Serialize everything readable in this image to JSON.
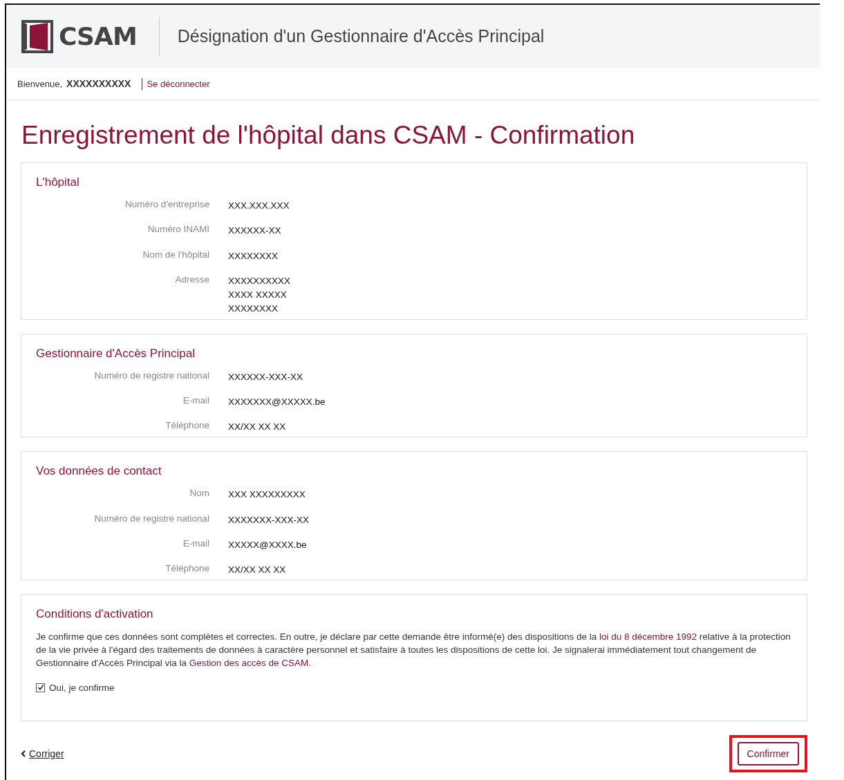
{
  "header": {
    "logo": "CSAM",
    "title": "Désignation d'un Gestionnaire d'Accès Principal"
  },
  "user_bar": {
    "greeting": "Bienvenue,",
    "user": "XXXXXXXXXX",
    "logout": "Se déconnecter"
  },
  "page_title": "Enregistrement de l'hôpital dans CSAM - Confirmation",
  "sections": [
    {
      "title": "L'hôpital",
      "fields": [
        {
          "label": "Numéro d'entreprise",
          "value": [
            "XXX.XXX.XXX"
          ]
        },
        {
          "label": "Numéro INAMI",
          "value": [
            "XXXXXX-XX"
          ]
        },
        {
          "label": "Nom de l'hôpital",
          "value": [
            "XXXXXXXX"
          ]
        },
        {
          "label": "Adresse",
          "value": [
            "XXXXXXXXXX",
            "XXXX XXXXX",
            "XXXXXXXX"
          ]
        }
      ]
    },
    {
      "title": "Gestionnaire d'Accès Principal",
      "fields": [
        {
          "label": "Numéro de registre national",
          "value": [
            "XXXXXX-XXX-XX"
          ]
        },
        {
          "label": "E-mail",
          "value": [
            "XXXXXXX@XXXXX.be"
          ]
        },
        {
          "label": "Téléphone",
          "value": [
            "XX/XX XX XX"
          ]
        }
      ]
    },
    {
      "title": "Vos données de contact",
      "fields": [
        {
          "label": "Nom",
          "value": [
            "XXX XXXXXXXXX"
          ]
        },
        {
          "label": "Numéro de registre national",
          "value": [
            "XXXXXXX-XXX-XX"
          ]
        },
        {
          "label": "E-mail",
          "value": [
            "XXXXX@XXXX.be"
          ]
        },
        {
          "label": "Téléphone",
          "value": [
            "XX/XX XX XX"
          ]
        }
      ]
    }
  ],
  "conditions": {
    "title": "Conditions d'activation",
    "text": [
      {
        "kind": "text",
        "text": "Je confirme que ces données sont complètes et correctes. En outre, je déclare par cette demande être informé(e) des dispositions de la "
      },
      {
        "kind": "link",
        "text": "loi du 8 décembre 1992"
      },
      {
        "kind": "text",
        "text": " relative à la protection de la vie privée à l'égard des traitements de données à caractère personnel et satisfaire à toutes les dispositions de cette loi. Je signalerai immédiatement tout changement de Gestionnaire d'Accès Principal via la "
      },
      {
        "kind": "link",
        "text": "Gestion des accès de CSAM"
      },
      {
        "kind": "text",
        "text": "."
      }
    ],
    "checkbox": {
      "label": "Oui, je confirme",
      "checked": true
    }
  },
  "footer": {
    "back": "Corriger",
    "confirm": {
      "label": "Confirmer",
      "highlighted": true
    }
  }
}
